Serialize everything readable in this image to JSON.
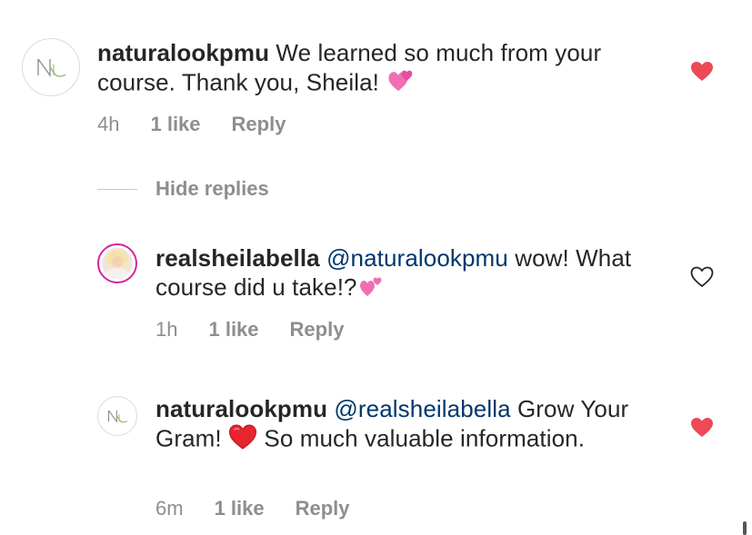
{
  "comments": [
    {
      "username": "naturalookpmu",
      "text": "We learned so much from your course. Thank you, Sheila!",
      "emoji": "revolving-hearts",
      "time": "4h",
      "likes": "1 like",
      "reply": "Reply",
      "liked": true
    },
    {
      "username": "realsheilabella",
      "mention": "@naturalookpmu",
      "text": "wow! What course did u take!?",
      "emoji": "two-hearts",
      "time": "1h",
      "likes": "1 like",
      "reply": "Reply",
      "liked": false
    },
    {
      "username": "naturalookpmu",
      "mention": "@realsheilabella",
      "text_before": "Grow Your Gram!",
      "emoji": "red-heart",
      "text_after": "So much valuable information.",
      "time": "6m",
      "likes": "1 like",
      "reply": "Reply",
      "liked": true
    }
  ],
  "hide_replies": "Hide replies",
  "colors": {
    "liked_heart": "#ed4956",
    "meta_text": "#8e8e8e",
    "mention": "#00376b",
    "story_ring": "#d6249f"
  }
}
